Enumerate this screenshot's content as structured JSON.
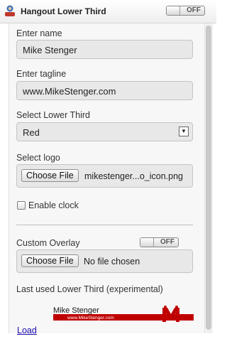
{
  "header": {
    "title": "Hangout Lower Third",
    "toggle_label": "OFF"
  },
  "form": {
    "name_label": "Enter name",
    "name_value": "Mike Stenger",
    "tagline_label": "Enter tagline",
    "tagline_value": "www.MikeStenger.com",
    "lower_third_label": "Select Lower Third",
    "lower_third_value": "Red",
    "logo_label": "Select logo",
    "choose_file_label": "Choose File",
    "logo_file_value": "mikestenger...o_icon.png",
    "clock_label": "Enable clock",
    "overlay_label": "Custom Overlay",
    "overlay_toggle_label": "OFF",
    "overlay_file_value": "No file chosen",
    "last_used_label": "Last used Lower Third (experimental)",
    "load_label": "Load"
  },
  "preview": {
    "name": "Mike Stenger",
    "tagline": "www.MikeStenger.com",
    "accent_color": "#c00000"
  }
}
